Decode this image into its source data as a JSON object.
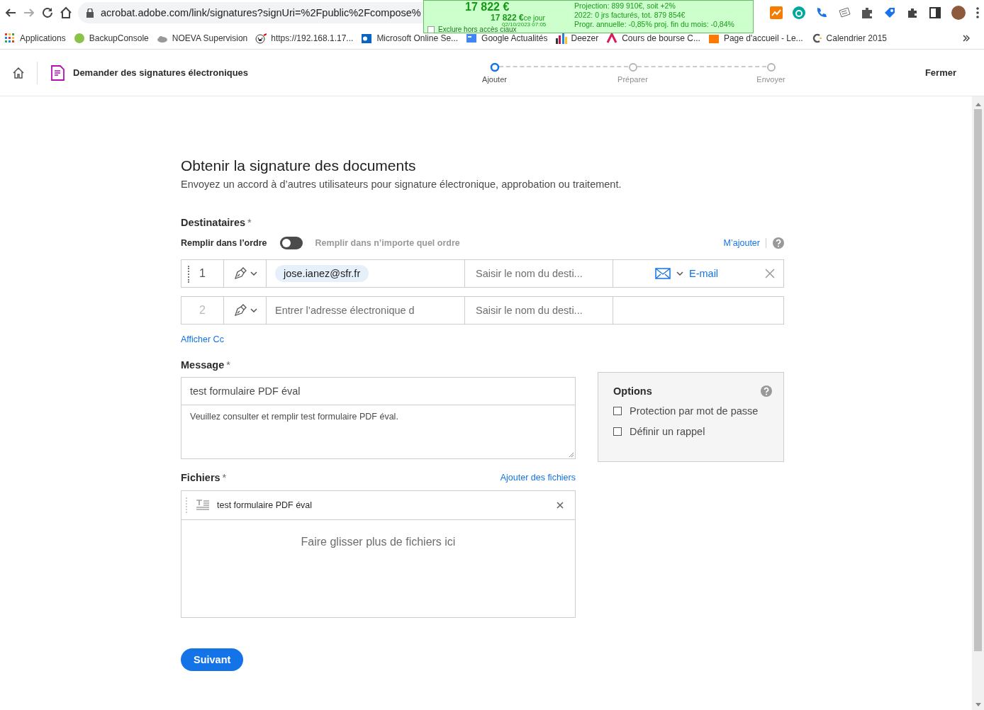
{
  "browser": {
    "url": "acrobat.adobe.com/link/signatures?signUri=%2Fpublic%2Fcompose%",
    "bookmarks": [
      {
        "label": "Applications",
        "kind": "grid"
      },
      {
        "label": "BackupConsole",
        "kind": "ball"
      },
      {
        "label": "NOEVA Supervision",
        "kind": "cloud"
      },
      {
        "label": "https://192.168.1.17...",
        "kind": "w"
      },
      {
        "label": "Microsoft Online Se...",
        "kind": "outlook"
      },
      {
        "label": "Google Actualités",
        "kind": "news"
      },
      {
        "label": "Deezer",
        "kind": "bars"
      },
      {
        "label": "Cours de bourse C...",
        "kind": "swirl"
      },
      {
        "label": "Page d'accueil - Le...",
        "kind": "orange"
      },
      {
        "label": "Calendrier 2015",
        "kind": "c"
      }
    ]
  },
  "extension_popup": {
    "total": "17 822 €",
    "today": "17 822 €",
    "today_suffix": "ce jour",
    "timestamp": "02/10/2023 07:05",
    "exclude": {
      "label": "Exclure hors accès ciaux",
      "checked": false
    },
    "lines": [
      "Projection: 899 910€, soit +2%",
      "2022: 0 jrs facturés, tot. 879 854€",
      "Progr. annuelle: -0,85% proj. fin du mois: -0,84%"
    ]
  },
  "header": {
    "title": "Demander des signatures électroniques",
    "steps": [
      {
        "label": "Ajouter",
        "selected": true
      },
      {
        "label": "Préparer",
        "selected": false
      },
      {
        "label": "Envoyer",
        "selected": false
      }
    ],
    "close": "Fermer"
  },
  "form": {
    "title": "Obtenir la signature des documents",
    "subtitle": "Envoyez un accord à d’autres utilisateurs pour signature électronique, approbation ou traitement.",
    "recipients_label": "Destinataires",
    "required_mark": "*",
    "order_label": "Remplir dans l’ordre",
    "order_toggle": {
      "on": false
    },
    "any_order_label": "Remplir dans n’importe quel ordre",
    "add_me": "M’ajouter",
    "recipients": [
      {
        "number": "1",
        "email": "jose.ianez@sfr.fr",
        "name_placeholder": "Saisir le nom du desti...",
        "delivery": "E-mail"
      },
      {
        "number": "2",
        "email_placeholder": "Entrer l’adresse électronique d",
        "name_placeholder": "Saisir le nom du desti..."
      }
    ],
    "show_cc": "Afficher Cc",
    "message": {
      "label": "Message",
      "subject": "test formulaire PDF éval",
      "body": "Veuillez consulter et remplir test formulaire PDF éval."
    },
    "options": {
      "title": "Options",
      "items": [
        {
          "label": "Protection par mot de passe",
          "checked": false
        },
        {
          "label": "Définir un rappel",
          "checked": false
        }
      ]
    },
    "files": {
      "label": "Fichiers",
      "add": "Ajouter des fichiers",
      "items": [
        {
          "name": "test formulaire PDF éval"
        }
      ],
      "drop": "Faire glisser plus de fichiers ici"
    },
    "next": "Suivant"
  }
}
